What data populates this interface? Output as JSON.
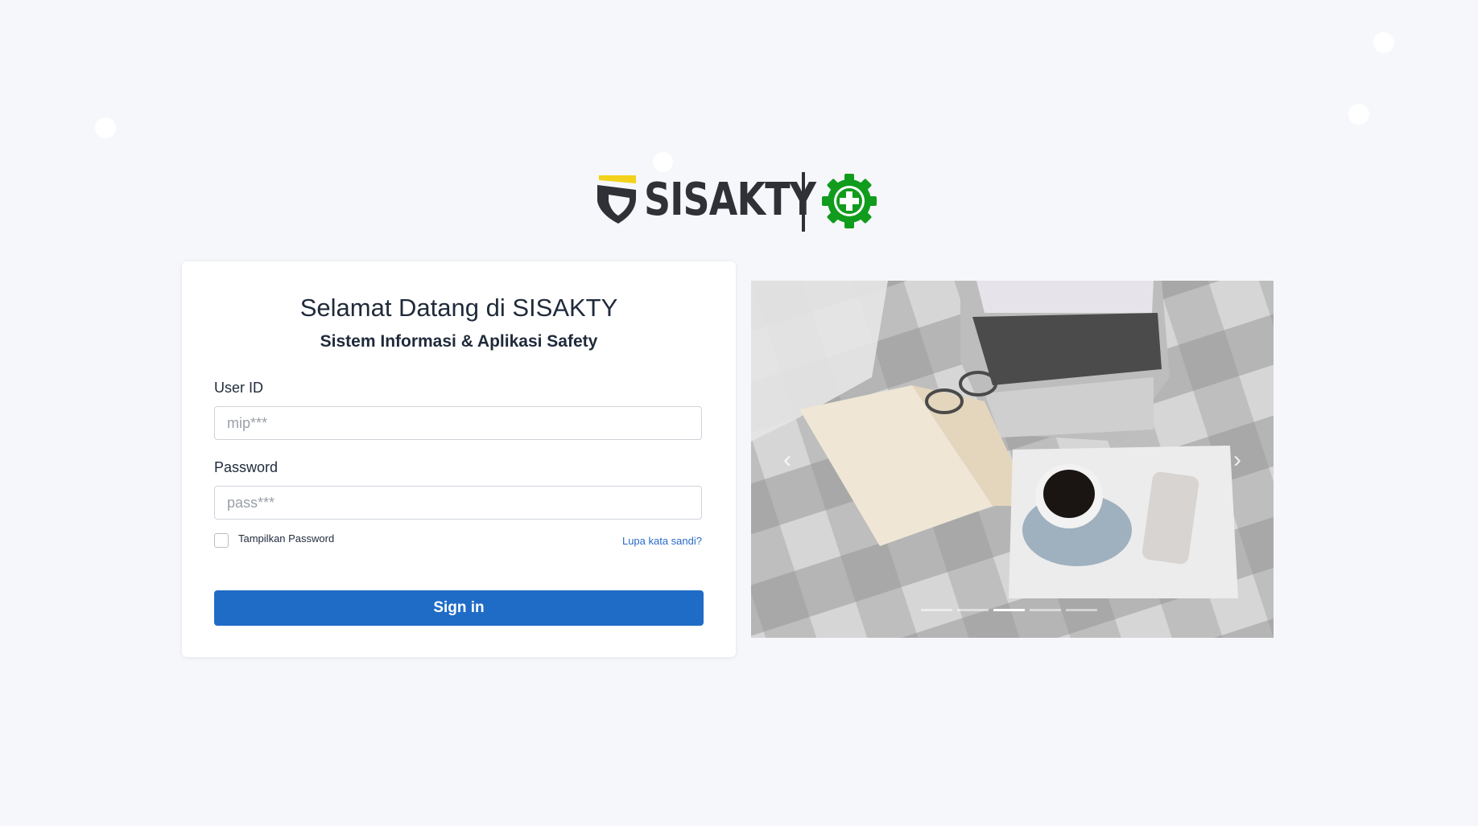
{
  "logo": {
    "brand": "SISAKTY",
    "icon": "safety-gear-cross-icon",
    "accent": "#f2d21a",
    "gear_color": "#119c1d"
  },
  "login": {
    "title": "Selamat Datang di SISAKTY",
    "subtitle": "Sistem Informasi & Aplikasi Safety",
    "userid_label": "User ID",
    "userid_placeholder": "mip***",
    "password_label": "Password",
    "password_placeholder": "pass***",
    "show_password_label": "Tampilkan Password",
    "forgot_label": "Lupa kata sandi?",
    "signin_label": "Sign in"
  },
  "carousel": {
    "prev_icon": "‹",
    "next_icon": "›",
    "slide_count": 5,
    "active_slide": 3,
    "slide_subject": "laptop, open book, glasses, coffee cup and phone on a plaid blanket"
  },
  "colors": {
    "primary": "#1f6cc7",
    "background": "#f6f7fa",
    "link": "#2a6bc9"
  }
}
